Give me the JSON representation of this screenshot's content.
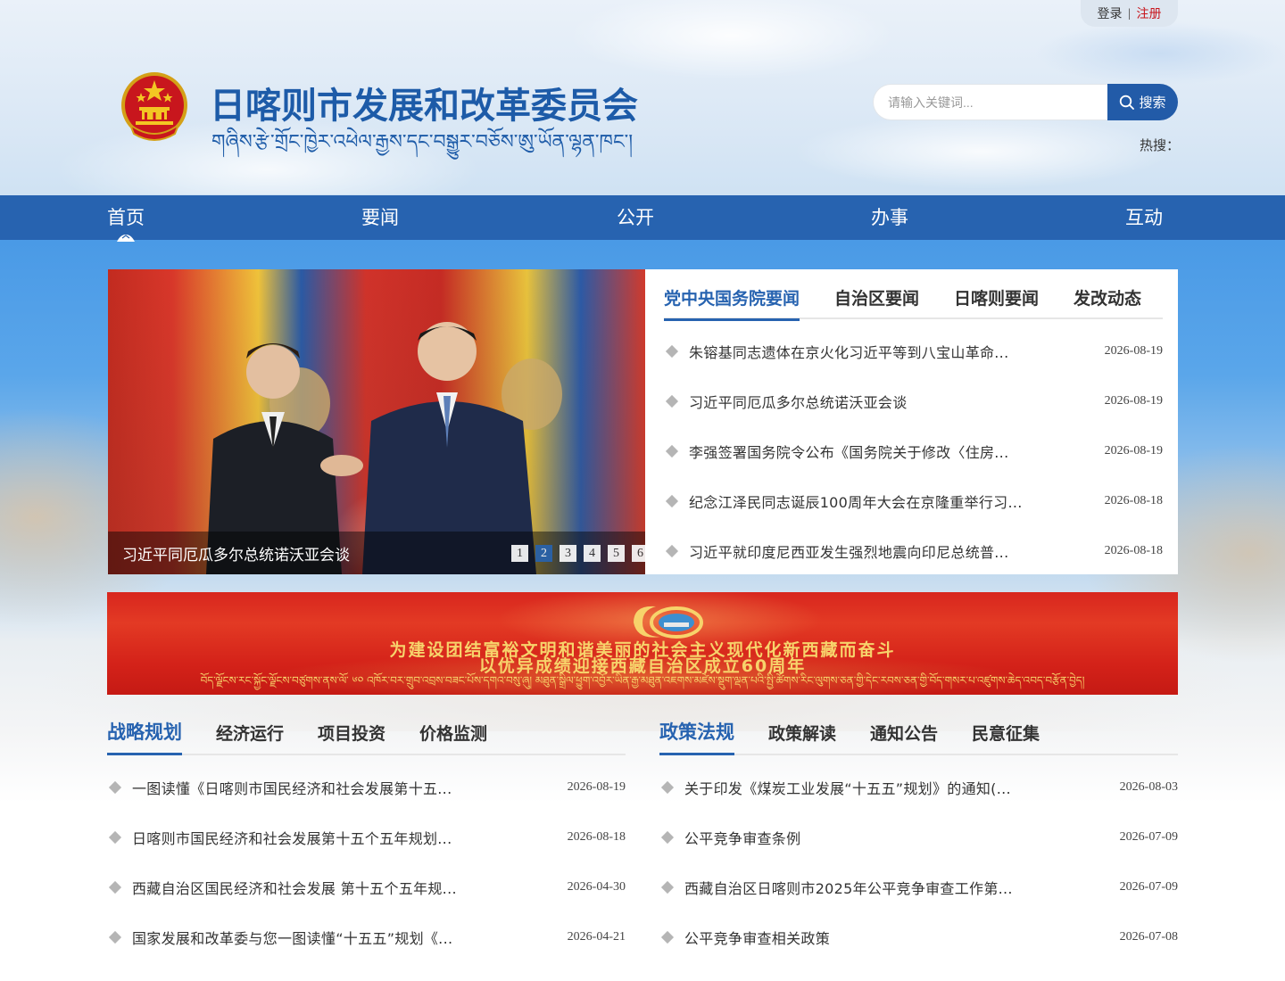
{
  "top_bar": {
    "login": "登录",
    "separator": "|",
    "register": "注册"
  },
  "header": {
    "title": "日喀则市发展和改革委员会",
    "subtitle": "གཞིས་རྩེ་གྲོང་ཁྱེར་འཕེལ་རྒྱས་དང་བསྒྱུར་བཅོས་ཨུ་ཡོན་ལྷན་ཁང་།"
  },
  "search": {
    "placeholder": "请输入关键词...",
    "button": "搜索",
    "hot_label": "热搜："
  },
  "nav": [
    "首页",
    "要闻",
    "公开",
    "办事",
    "互动"
  ],
  "slider": {
    "caption": "习近平同厄瓜多尔总统诺沃亚会谈",
    "dots": [
      "1",
      "2",
      "3",
      "4",
      "5",
      "6"
    ],
    "active_dot": 2
  },
  "news_panel": {
    "tabs": [
      "党中央国务院要闻",
      "自治区要闻",
      "日喀则要闻",
      "发改动态"
    ],
    "items": [
      {
        "title": "朱镕基同志遗体在京火化习近平等到八宝山革命...",
        "date": "2026-08-19"
      },
      {
        "title": "习近平同厄瓜多尔总统诺沃亚会谈",
        "date": "2026-08-19"
      },
      {
        "title": "李强签署国务院令公布《国务院关于修改〈住房...",
        "date": "2026-08-19"
      },
      {
        "title": "纪念江泽民同志诞辰100周年大会在京隆重举行习...",
        "date": "2026-08-18"
      },
      {
        "title": "习近平就印度尼西亚发生强烈地震向印尼总统普...",
        "date": "2026-08-18"
      }
    ]
  },
  "banner": {
    "line1": "为建设团结富裕文明和谐美丽的社会主义现代化新西藏而奋斗",
    "line2": "以优异成绩迎接西藏自治区成立60周年",
    "tibetan": "བོད་ལྗོངས་རང་སྐྱོང་ལྗོངས་བཙུགས་ནས་ལོ་ ༦༠ འཁོར་བར་གྲུབ་འབྲས་བཟང་པོས་དགའ་བསུ་ཞུ། མཐུན་སྒྲིལ་ཕྱུག་འབྱོར་ཡིན་རྒྱ་མཐུན་འཇགས་མཛེས་སྡུག་ལྡན་པའི་སྤྱི་ཚོགས་རིང་ལུགས་ཅན་གྱི་དེང་རབས་ཅན་གྱི་བོད་གསར་པ་འཛུགས་ཆེད་འབད་བརྩོན་བྱེད།"
  },
  "left_column": {
    "tabs": [
      "战略规划",
      "经济运行",
      "项目投资",
      "价格监测"
    ],
    "items": [
      {
        "title": "一图读懂《日喀则市国民经济和社会发展第十五...",
        "date": "2026-08-19"
      },
      {
        "title": "日喀则市国民经济和社会发展第十五个五年规划...",
        "date": "2026-08-18"
      },
      {
        "title": "西藏自治区国民经济和社会发展 第十五个五年规...",
        "date": "2026-04-30"
      },
      {
        "title": "国家发展和改革委与您一图读懂“十五五”规划《...",
        "date": "2026-04-21"
      }
    ]
  },
  "right_column": {
    "tabs": [
      "政策法规",
      "政策解读",
      "通知公告",
      "民意征集"
    ],
    "items": [
      {
        "title": "关于印发《煤炭工业发展“十五五”规划》的通知(...",
        "date": "2026-08-03"
      },
      {
        "title": "公平竞争审查条例",
        "date": "2026-07-09"
      },
      {
        "title": "西藏自治区日喀则市2025年公平竞争审查工作第...",
        "date": "2026-07-09"
      },
      {
        "title": "公平竞争审查相关政策",
        "date": "2026-07-08"
      }
    ]
  },
  "colors": {
    "brand_blue": "#2763b0",
    "title_blue": "#1d5ba8",
    "register_red": "#c8161d",
    "banner_red": "#d8261e",
    "banner_gold": "#f7d36b"
  }
}
